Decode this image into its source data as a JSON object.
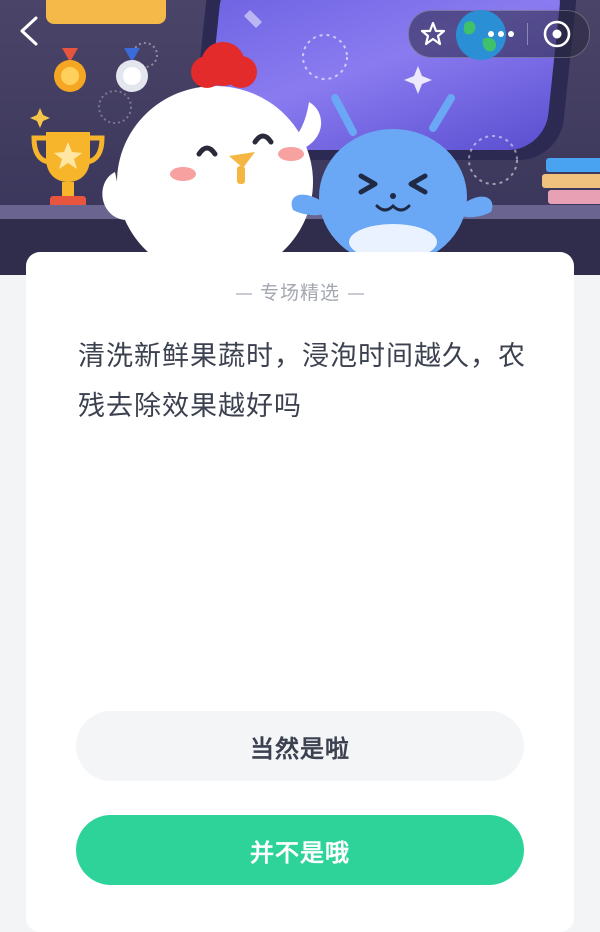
{
  "header": {
    "nav": {
      "back_icon": "chevron-left-icon",
      "favorite_icon": "star-icon",
      "globe_icon": "globe-icon",
      "more_icon": "more-dots-icon",
      "close_icon": "target-circle-icon"
    }
  },
  "card": {
    "tag": "专场精选",
    "question": "清洗新鲜果蔬时，浸泡时间越久，农残去除效果越好吗"
  },
  "options": [
    {
      "label": "当然是啦"
    },
    {
      "label": "并不是哦"
    }
  ],
  "colors": {
    "header_bg": "#4a4468",
    "primary_green": "#2ed39a",
    "text_dark": "#3c4150",
    "tag_gray": "#a3a7b0"
  }
}
